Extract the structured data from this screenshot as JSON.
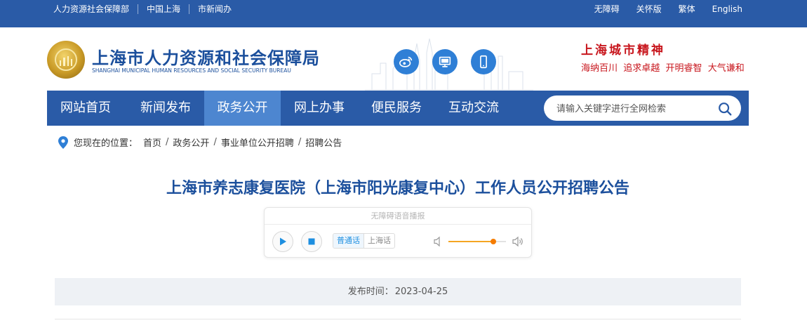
{
  "topbar": {
    "left_links": [
      "人力资源社会保障部",
      "中国上海",
      "市新闻办"
    ],
    "right_links": [
      "无障碍",
      "关怀版",
      "繁体",
      "English"
    ]
  },
  "header": {
    "site_title": "上海市人力资源和社会保障局",
    "site_subtitle": "SHANGHAI MUNICIPAL HUMAN RESOURCES AND SOCIAL SECURITY BUREAU",
    "social_icons": [
      "weibo-icon",
      "desktop-icon",
      "mobile-icon"
    ],
    "spirit_title": "上海城市精神",
    "spirit_motto": "海纳百川  追求卓越  开明睿智  大气谦和"
  },
  "nav": {
    "items": [
      "网站首页",
      "新闻发布",
      "政务公开",
      "网上办事",
      "便民服务",
      "互动交流"
    ],
    "active": "政务公开",
    "search_placeholder": "请输入关键字进行全网检索"
  },
  "breadcrumb": {
    "label": "您现在的位置：",
    "items": [
      "首页",
      "政务公开",
      "事业单位公开招聘",
      "招聘公告"
    ]
  },
  "article": {
    "title": "上海市养志康复医院（上海市阳光康复中心）工作人员公开招聘公告",
    "publish_label": "发布时间：",
    "publish_date": "2023-04-25"
  },
  "player": {
    "heading": "无障碍语音播报",
    "dialects": [
      "普通话",
      "上海话"
    ],
    "active_dialect": "普通话",
    "volume_fraction": 0.78
  },
  "colors": {
    "brand_blue": "#2a5ba7",
    "nav_active": "#4d86d0",
    "title_blue": "#1b4f9c",
    "spirit_red": "#c8161d",
    "volume_orange": "#f57c00"
  }
}
